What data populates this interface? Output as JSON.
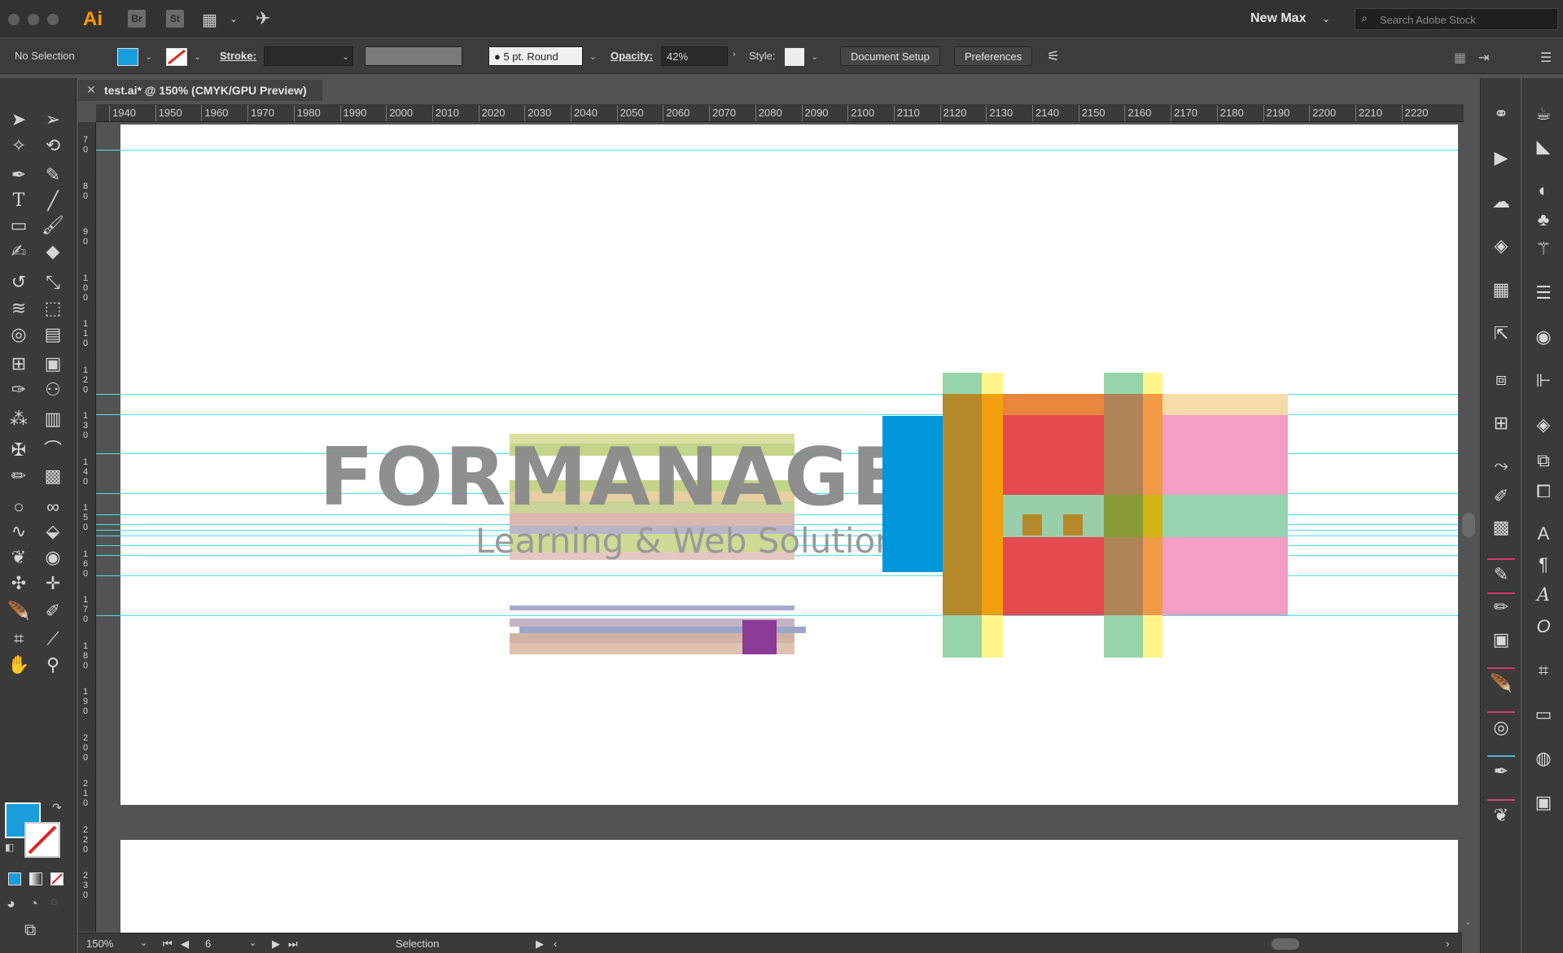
{
  "app": {
    "badges": [
      "Ai",
      "Br",
      "St"
    ],
    "workspace": "New Max",
    "search_placeholder": "Search Adobe Stock"
  },
  "control": {
    "selection_state": "No Selection",
    "stroke_label": "Stroke:",
    "brush": "5 pt. Round",
    "opacity_label": "Opacity:",
    "opacity_value": "42%",
    "style_label": "Style:",
    "document_setup": "Document Setup",
    "preferences": "Preferences"
  },
  "document": {
    "tab_title": "test.ai* @ 150% (CMYK/GPU Preview)"
  },
  "ruler": {
    "h_labels": [
      "1940",
      "1950",
      "1960",
      "1970",
      "1980",
      "1990",
      "2000",
      "2010",
      "2020",
      "2030",
      "2040",
      "2050",
      "2060",
      "2070",
      "2080",
      "2090",
      "2100",
      "2110",
      "2120",
      "2130",
      "2140",
      "2150",
      "2160",
      "2170",
      "2180",
      "2190",
      "2200",
      "2210",
      "2220"
    ],
    "v_labels": [
      "7 0",
      "8 0",
      "9 0",
      "1 0 0",
      "1 1 0",
      "1 2 0",
      "1 3 0",
      "1 4 0",
      "1 5 0",
      "1 6 0",
      "1 7 0",
      "1 8 0",
      "1 9 0",
      "2 0 0",
      "2 1 0",
      "2 2 0",
      "2 3 0"
    ]
  },
  "artwork": {
    "logo_title": "FORMANAGER",
    "logo_subtitle": "Learning & Web Solutions"
  },
  "status": {
    "zoom": "150%",
    "artboard": "6",
    "tool": "Selection"
  },
  "colors": {
    "fill": "#1a9edb",
    "guide": "#4fe0ea",
    "accent_pink": "#d63a6f"
  }
}
